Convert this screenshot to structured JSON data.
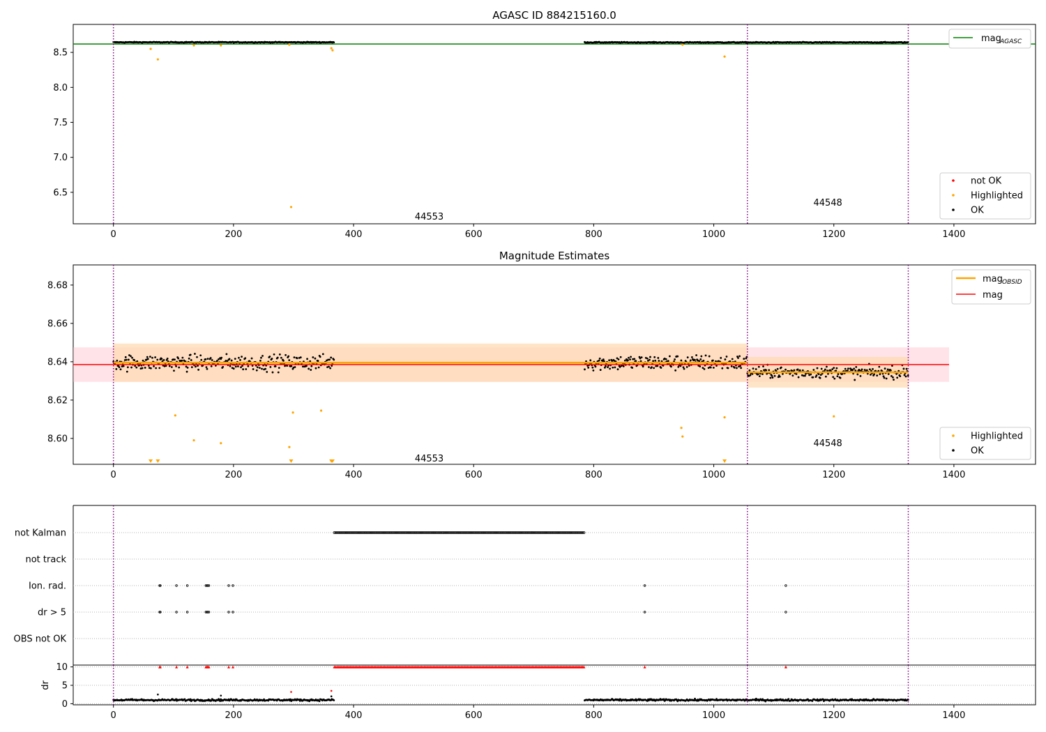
{
  "figure": {
    "title": "AGASC ID 884215160.0",
    "subtitle": "Magnitude Estimates"
  },
  "colors": {
    "ok": "#000000",
    "highlighted": "#ffa500",
    "not_ok": "#ff0000",
    "mag_agasc": "#008000",
    "mag_obsid": "#ffa500",
    "mag": "#ff0000",
    "obs_boundary": "#800080",
    "band_mag": "#ffc0cb",
    "band_obsid": "#ffdab0"
  },
  "chart_data": [
    {
      "name": "agasc-panel",
      "type": "scatter",
      "title": "AGASC ID 884215160.0",
      "xlim": [
        -67,
        1536
      ],
      "ylim": [
        6.05,
        8.9
      ],
      "xticks": [
        "0",
        "200",
        "400",
        "600",
        "800",
        "1000",
        "1200",
        "1400"
      ],
      "xtick_values": [
        0,
        200,
        400,
        600,
        800,
        1000,
        1200,
        1400
      ],
      "yticks": [
        "6.5",
        "7.0",
        "7.5",
        "8.0",
        "8.5"
      ],
      "ytick_values": [
        6.5,
        7.0,
        7.5,
        8.0,
        8.5
      ],
      "obs_boundaries": [
        0,
        1056,
        1324
      ],
      "annotations": [
        {
          "text": "44553",
          "x": 502,
          "y": 6.15
        },
        {
          "text": "44548",
          "x": 1166,
          "y": 6.35
        }
      ],
      "hlines": [
        {
          "name": "mag_AGASC",
          "y": 8.62,
          "x": [
            -67,
            1536
          ],
          "color": "#008000"
        }
      ],
      "ok_segments": [
        {
          "x": [
            0,
            368
          ],
          "center": 8.645,
          "spread": 0.012
        },
        {
          "x": [
            785,
            1324
          ],
          "center": 8.643,
          "spread": 0.012
        }
      ],
      "highlighted_points": [
        {
          "x": 62,
          "y": 8.55
        },
        {
          "x": 74,
          "y": 8.4
        },
        {
          "x": 134,
          "y": 8.6
        },
        {
          "x": 179,
          "y": 8.6
        },
        {
          "x": 293,
          "y": 8.61
        },
        {
          "x": 296,
          "y": 6.29
        },
        {
          "x": 363,
          "y": 8.56
        },
        {
          "x": 365,
          "y": 8.53
        },
        {
          "x": 948,
          "y": 8.61
        },
        {
          "x": 1018,
          "y": 8.44
        }
      ],
      "legend_lines": [
        {
          "label": "mag",
          "sub": "AGASC"
        }
      ],
      "legend_points": [
        "not OK",
        "Highlighted",
        "OK"
      ]
    },
    {
      "name": "estimates-panel",
      "type": "scatter",
      "title": "Magnitude Estimates",
      "xlim": [
        -67,
        1536
      ],
      "ylim": [
        8.5865,
        8.6905
      ],
      "xticks": [
        "0",
        "200",
        "400",
        "600",
        "800",
        "1000",
        "1200",
        "1400"
      ],
      "xtick_values": [
        0,
        200,
        400,
        600,
        800,
        1000,
        1200,
        1400
      ],
      "yticks": [
        "8.60",
        "8.62",
        "8.64",
        "8.66",
        "8.68"
      ],
      "ytick_values": [
        8.6,
        8.62,
        8.64,
        8.66,
        8.68
      ],
      "obs_boundaries": [
        0,
        1056,
        1324
      ],
      "annotations": [
        {
          "text": "44553",
          "x": 502,
          "y": 8.5895
        },
        {
          "text": "44548",
          "x": 1166,
          "y": 8.5975
        }
      ],
      "mag_line": {
        "y": 8.6385,
        "x": [
          -67,
          1392
        ],
        "band": [
          8.6295,
          8.6475
        ]
      },
      "obsid_segments": [
        {
          "x": [
            0,
            1056
          ],
          "y": 8.6395,
          "band": [
            8.6295,
            8.6495
          ]
        },
        {
          "x": [
            1056,
            1324
          ],
          "y": 8.6345,
          "band": [
            8.6265,
            8.6425
          ]
        }
      ],
      "ok_segments": [
        {
          "x": [
            0,
            368
          ],
          "center": 8.6395,
          "spread": 0.008
        },
        {
          "x": [
            785,
            1056
          ],
          "center": 8.6395,
          "spread": 0.008
        },
        {
          "x": [
            1056,
            1324
          ],
          "center": 8.6345,
          "spread": 0.006
        }
      ],
      "highlighted_points": [
        {
          "x": 103,
          "y": 8.612
        },
        {
          "x": 134,
          "y": 8.599
        },
        {
          "x": 179,
          "y": 8.5975
        },
        {
          "x": 293,
          "y": 8.5955
        },
        {
          "x": 299,
          "y": 8.6135
        },
        {
          "x": 346,
          "y": 8.6145
        },
        {
          "x": 946,
          "y": 8.6055
        },
        {
          "x": 948,
          "y": 8.601
        },
        {
          "x": 1018,
          "y": 8.611
        },
        {
          "x": 1200,
          "y": 8.6115
        }
      ],
      "offscale_markers": [
        62,
        74,
        296,
        363,
        365,
        1018
      ],
      "legend_lines": [
        {
          "label": "mag",
          "sub": "OBSID"
        },
        {
          "label": "mag",
          "sub": ""
        }
      ],
      "legend_points": [
        "Highlighted",
        "OK"
      ]
    },
    {
      "name": "flags-panel",
      "type": "scatter",
      "xlim": [
        -67,
        1536
      ],
      "categories": [
        "not Kalman",
        "not track",
        "Ion. rad.",
        "dr > 5",
        "OBS not OK"
      ],
      "obs_boundaries": [
        0,
        1056,
        1324
      ],
      "flags": {
        "not Kalman": {
          "range": [
            368,
            785
          ]
        },
        "not track": {
          "points": []
        },
        "Ion. rad.": {
          "points": [
            77,
            78,
            105,
            123,
            154,
            156,
            157,
            159,
            192,
            199,
            885,
            1120
          ]
        },
        "dr > 5": {
          "points": [
            77,
            78,
            105,
            123,
            154,
            156,
            157,
            159,
            192,
            199,
            885,
            1120
          ]
        },
        "OBS not OK": {
          "points": []
        }
      }
    },
    {
      "name": "dr-panel",
      "type": "scatter",
      "ylabel": "dr",
      "xlim": [
        -67,
        1536
      ],
      "ylim": [
        -0.3,
        10.5
      ],
      "xticks": [
        "0",
        "200",
        "400",
        "600",
        "800",
        "1000",
        "1200",
        "1400"
      ],
      "xtick_values": [
        0,
        200,
        400,
        600,
        800,
        1000,
        1200,
        1400
      ],
      "yticks": [
        "0",
        "5",
        "10"
      ],
      "ytick_values": [
        0,
        5,
        10
      ],
      "obs_boundaries": [
        0,
        1056,
        1324
      ],
      "red_clip_range": [
        368,
        785
      ],
      "red_clip_points": [
        77,
        78,
        105,
        123,
        154,
        156,
        157,
        159,
        192,
        199,
        885,
        1120
      ],
      "red_points": [
        {
          "x": 296,
          "y": 3.2
        },
        {
          "x": 363,
          "y": 3.5
        }
      ],
      "ok_segments": [
        {
          "x": [
            0,
            368
          ],
          "center": 1.0,
          "spread": 0.5
        },
        {
          "x": [
            785,
            1324
          ],
          "center": 1.0,
          "spread": 0.5
        }
      ],
      "extra_points": [
        {
          "x": 74,
          "y": 2.5
        },
        {
          "x": 179,
          "y": 2.2
        },
        {
          "x": 363,
          "y": 2.0
        }
      ]
    }
  ]
}
